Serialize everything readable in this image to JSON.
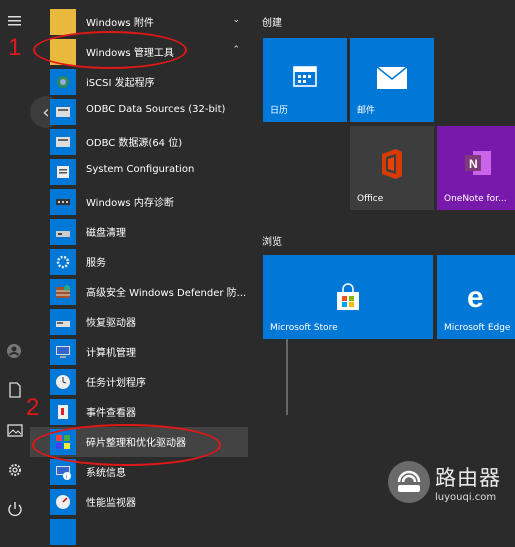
{
  "rail": {
    "icons": [
      "hamburger-icon",
      "user-icon",
      "document-icon",
      "picture-icon",
      "settings-icon",
      "power-icon"
    ]
  },
  "apps": [
    {
      "label": "Windows 附件",
      "chev": "⌄"
    },
    {
      "label": "Windows 管理工具",
      "chev": "⌃"
    },
    {
      "label": "iSCSI 发起程序"
    },
    {
      "label": "ODBC Data Sources (32-bit)"
    },
    {
      "label": "ODBC 数据源(64 位)"
    },
    {
      "label": "System Configuration"
    },
    {
      "label": "Windows 内存诊断"
    },
    {
      "label": "磁盘清理"
    },
    {
      "label": "服务"
    },
    {
      "label": "高级安全 Windows Defender 防..."
    },
    {
      "label": "恢复驱动器"
    },
    {
      "label": "计算机管理"
    },
    {
      "label": "任务计划程序"
    },
    {
      "label": "事件查看器"
    },
    {
      "label": "碎片整理和优化驱动器"
    },
    {
      "label": "系统信息"
    },
    {
      "label": "性能监视器"
    }
  ],
  "groups": {
    "create": "创建",
    "browse": "浏览"
  },
  "tiles": {
    "calendar": "日历",
    "mail": "邮件",
    "office": "Office",
    "onenote": "OneNote for...",
    "store": "Microsoft Store",
    "edge": "Microsoft Edge"
  },
  "annotations": {
    "n1": "1",
    "n2": "2"
  },
  "watermark": {
    "title": "路由器",
    "url": "luyouqi.com"
  },
  "colors": {
    "accent": "#0078d7",
    "mark": "#e01818"
  }
}
